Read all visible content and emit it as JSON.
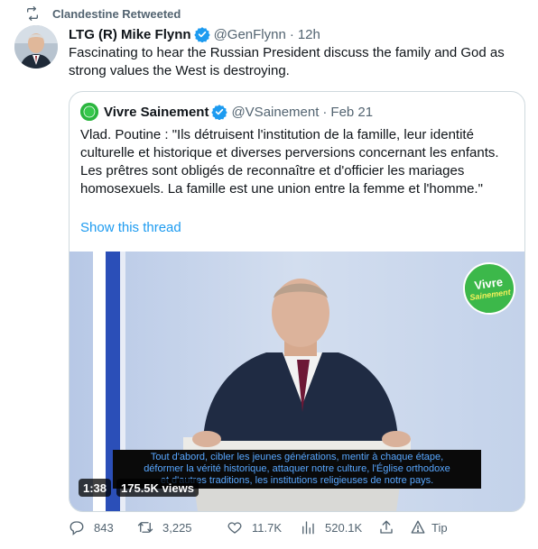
{
  "retweet_banner": {
    "text": "Clandestine Retweeted"
  },
  "tweet": {
    "author_name": "LTG (R) Mike Flynn",
    "handle": "@GenFlynn",
    "separator": "·",
    "time": "12h",
    "text": "Fascinating to hear the Russian President discuss the family and God as strong values the West is destroying."
  },
  "quote": {
    "author_name": "Vivre Sainement",
    "handle": "@VSainement",
    "separator": "·",
    "time": "Feb 21",
    "text": "Vlad. Poutine : \"Ils détruisent l'institution de la famille, leur identité culturelle et historique et diverses perversions concernant les enfants. Les prêtres sont obligés de reconnaître et d'officier les mariages homosexuels. La famille est une union entre la femme et l'homme.\"",
    "show_thread": "Show this thread",
    "video": {
      "badge_line1": "Vivre",
      "badge_line2": "Sainement",
      "subtitle_lines": [
        "Tout d'abord, cibler les jeunes générations, mentir à chaque étape,",
        "déformer la vérité historique, attaquer notre culture, l'Église orthodoxe",
        "et d'autres traditions, les institutions religieuses de notre pays."
      ],
      "duration": "1:38",
      "views": "175.5K views"
    }
  },
  "actions": {
    "replies": "843",
    "retweets": "3,225",
    "likes": "11.7K",
    "views": "520.1K",
    "tip": "Tip"
  },
  "colors": {
    "accent": "#1d9bf0",
    "secondary_text": "#536471",
    "border": "#cfd9de",
    "verified": "#1d9bf0"
  }
}
